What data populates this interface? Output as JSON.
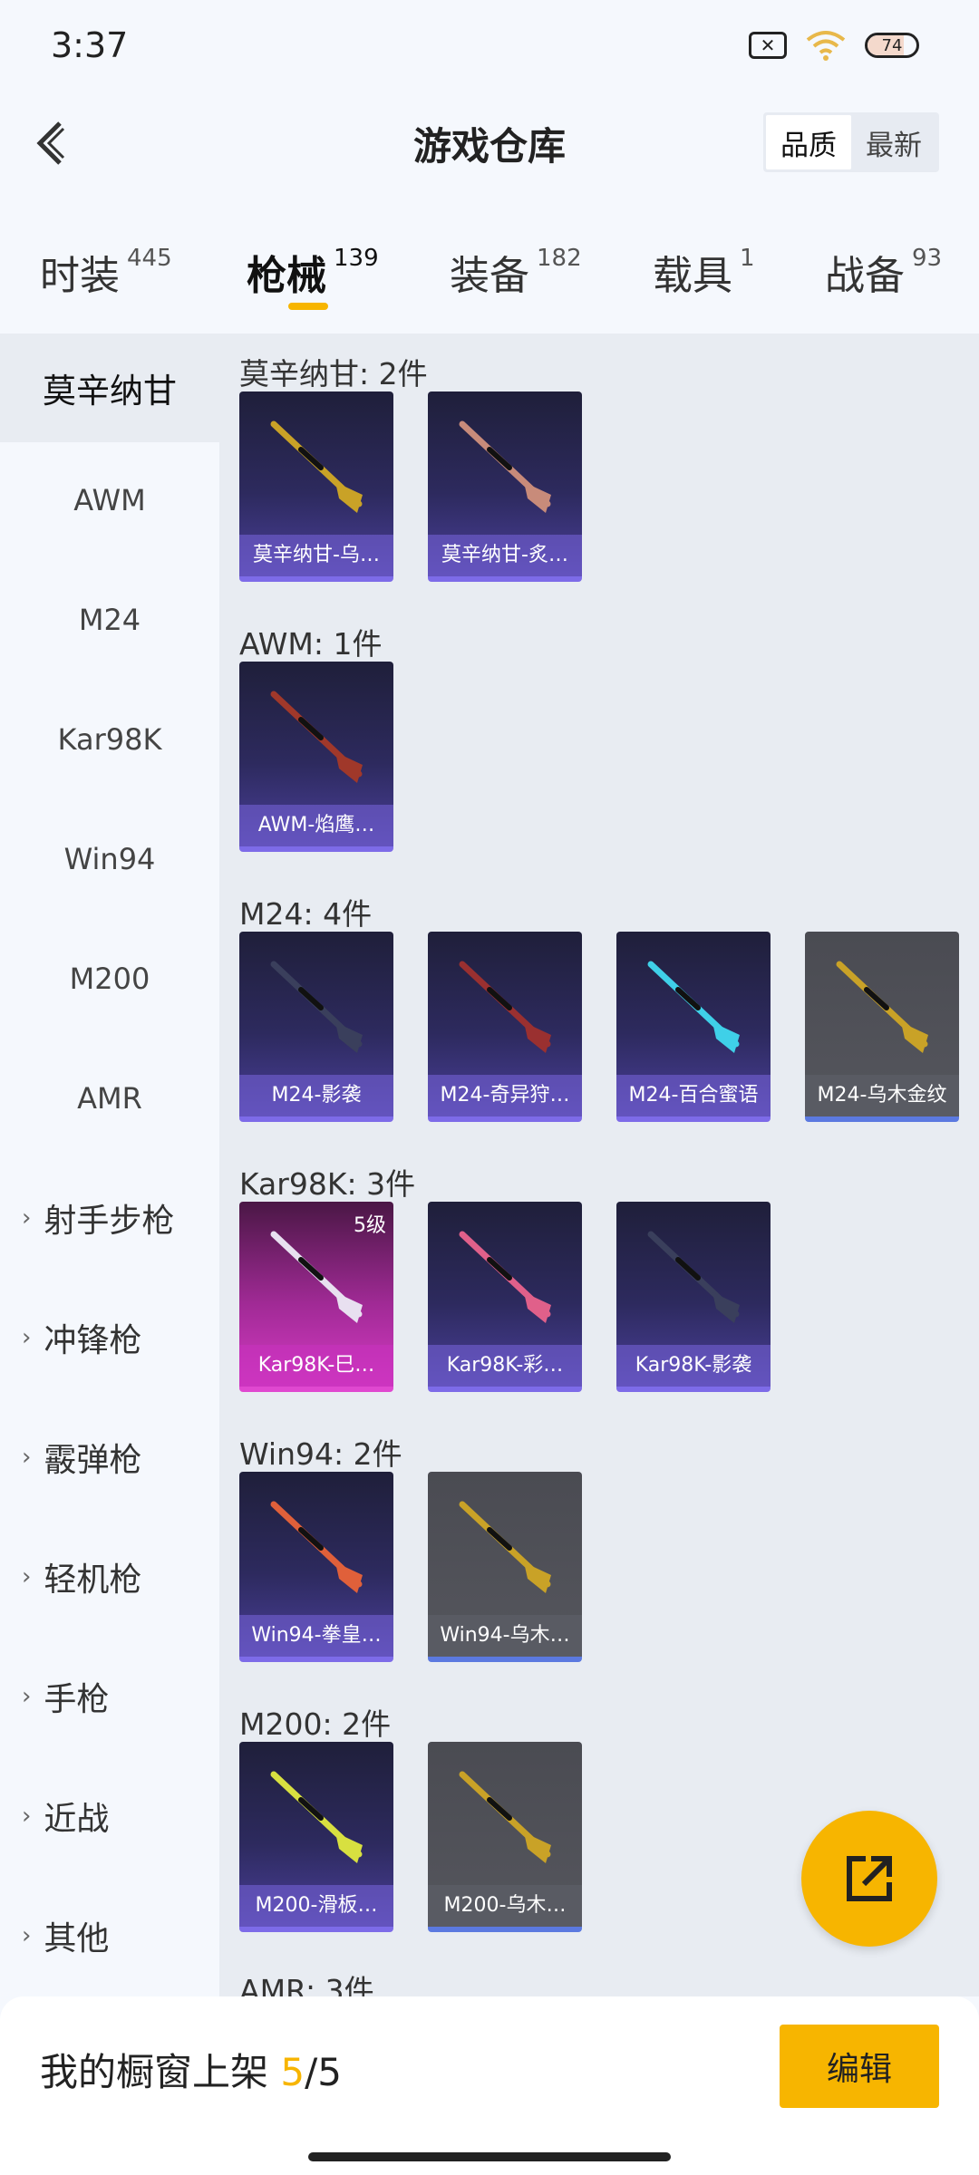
{
  "status_bar": {
    "time": "3:37",
    "battery": "74",
    "battery_level": 0.74
  },
  "header": {
    "title": "游戏仓库",
    "sort_options": [
      "品质",
      "最新"
    ],
    "sort_active": "品质"
  },
  "tabs": [
    {
      "label": "时装",
      "count": "445"
    },
    {
      "label": "枪械",
      "count": "139"
    },
    {
      "label": "装备",
      "count": "182"
    },
    {
      "label": "载具",
      "count": "1"
    },
    {
      "label": "战备",
      "count": "93"
    }
  ],
  "sidebar": {
    "items": [
      {
        "label": "莫辛纳甘"
      },
      {
        "label": "AWM"
      },
      {
        "label": "M24"
      },
      {
        "label": "Kar98K"
      },
      {
        "label": "Win94"
      },
      {
        "label": "M200"
      },
      {
        "label": "AMR"
      }
    ],
    "groups": [
      {
        "label": "射手步枪"
      },
      {
        "label": "冲锋枪"
      },
      {
        "label": "霰弹枪"
      },
      {
        "label": "轻机枪"
      },
      {
        "label": "手枪"
      },
      {
        "label": "近战"
      },
      {
        "label": "其他"
      }
    ]
  },
  "sections": [
    {
      "title": "莫辛纳甘: 2件",
      "items": [
        {
          "label": "莫辛纳甘-乌…",
          "style": "purple",
          "gun_color": "#c9a227"
        },
        {
          "label": "莫辛纳甘-炙…",
          "style": "purple",
          "gun_color": "#c88b7a"
        }
      ]
    },
    {
      "title": "AWM: 1件",
      "items": [
        {
          "label": "AWM-焰鹰…",
          "style": "purple",
          "gun_color": "#a0382a"
        }
      ]
    },
    {
      "title": "M24: 4件",
      "items": [
        {
          "label": "M24-影袭",
          "style": "purple",
          "gun_color": "#3a3f5c"
        },
        {
          "label": "M24-奇异狩…",
          "style": "purple",
          "gun_color": "#9a3030"
        },
        {
          "label": "M24-百合蜜语",
          "style": "purple",
          "gun_color": "#3fd0e8"
        },
        {
          "label": "M24-乌木金纹",
          "style": "grey",
          "gun_color": "#c9a227"
        }
      ]
    },
    {
      "title": "Kar98K: 3件",
      "items": [
        {
          "label": "Kar98K-巳…",
          "style": "pink",
          "gun_color": "#e8e0f0",
          "level": "5级"
        },
        {
          "label": "Kar98K-彩…",
          "style": "purple",
          "gun_color": "#e0608a"
        },
        {
          "label": "Kar98K-影袭",
          "style": "purple",
          "gun_color": "#3a3f5c"
        }
      ]
    },
    {
      "title": "Win94: 2件",
      "items": [
        {
          "label": "Win94-拳皇…",
          "style": "purple",
          "gun_color": "#e0603a"
        },
        {
          "label": "Win94-乌木…",
          "style": "grey",
          "gun_color": "#c9a227"
        }
      ]
    },
    {
      "title": "M200: 2件",
      "items": [
        {
          "label": "M200-滑板…",
          "style": "purple",
          "gun_color": "#d8e040"
        },
        {
          "label": "M200-乌木…",
          "style": "grey",
          "gun_color": "#c9a227"
        }
      ]
    },
    {
      "title": "AMR: 3件",
      "items": []
    }
  ],
  "bottom": {
    "shelf_label": "我的橱窗上架",
    "shelf_used": "5",
    "shelf_total": "/5",
    "edit_label": "编辑"
  },
  "colors": {
    "accent": "#f7b500"
  }
}
